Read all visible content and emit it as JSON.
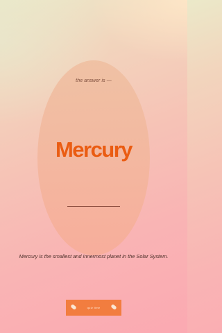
{
  "quiz": {
    "prompt": "the answer is —",
    "answer": "Mercury",
    "description": "Mercury is the smallest and innermost planet in the Solar System."
  },
  "button": {
    "label": "quiz time",
    "left_icon": "pill-icon",
    "right_icon": "pill-icon"
  },
  "colors": {
    "answer_text": "#ea5c12",
    "button_bg": "#f27d3f",
    "oval_fill": "#f3b79e"
  }
}
